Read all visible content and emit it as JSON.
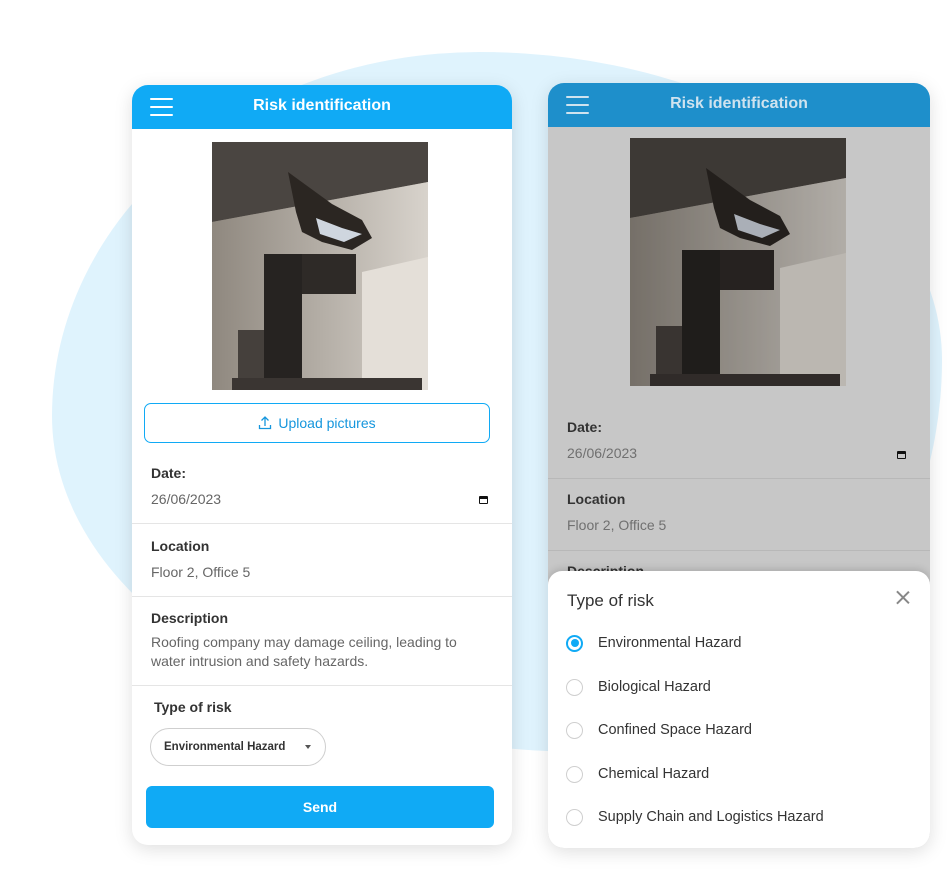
{
  "left_screen": {
    "header": {
      "title": "Risk identification",
      "menu_icon": "hamburger-menu-icon"
    },
    "upload_button": {
      "label": "Upload pictures",
      "icon": "upload-icon"
    },
    "date": {
      "label": "Date:",
      "value": "26/06/2023",
      "icon": "calendar-icon"
    },
    "location": {
      "label": "Location",
      "value": "Floor 2, Office 5"
    },
    "description": {
      "label": "Description",
      "line1": "Roofing company may damage ceiling, leading to",
      "line2": "water intrusion and safety hazards."
    },
    "risk_type": {
      "label": "Type of risk",
      "selected": "Environmental Hazard"
    },
    "send_button": {
      "label": "Send"
    }
  },
  "right_screen": {
    "header": {
      "title": "Risk identification",
      "menu_icon": "hamburger-menu-icon"
    },
    "date": {
      "label": "Date:",
      "value": "26/06/2023"
    },
    "location": {
      "label": "Location",
      "value": "Floor 2, Office 5"
    },
    "description": {
      "label": "Description"
    },
    "sheet": {
      "title": "Type of risk",
      "close_icon": "close-icon",
      "options": [
        {
          "label": "Environmental Hazard",
          "selected": true
        },
        {
          "label": "Biological Hazard",
          "selected": false
        },
        {
          "label": "Confined Space Hazard",
          "selected": false
        },
        {
          "label": "Chemical Hazard",
          "selected": false
        },
        {
          "label": "Supply Chain and Logistics Hazard",
          "selected": false
        }
      ]
    }
  },
  "colors": {
    "primary": "#10aaf5",
    "header_dimmed": "#1e8fcb",
    "background_blob": "#dff3fd",
    "overlay": "#c7c7c7"
  }
}
